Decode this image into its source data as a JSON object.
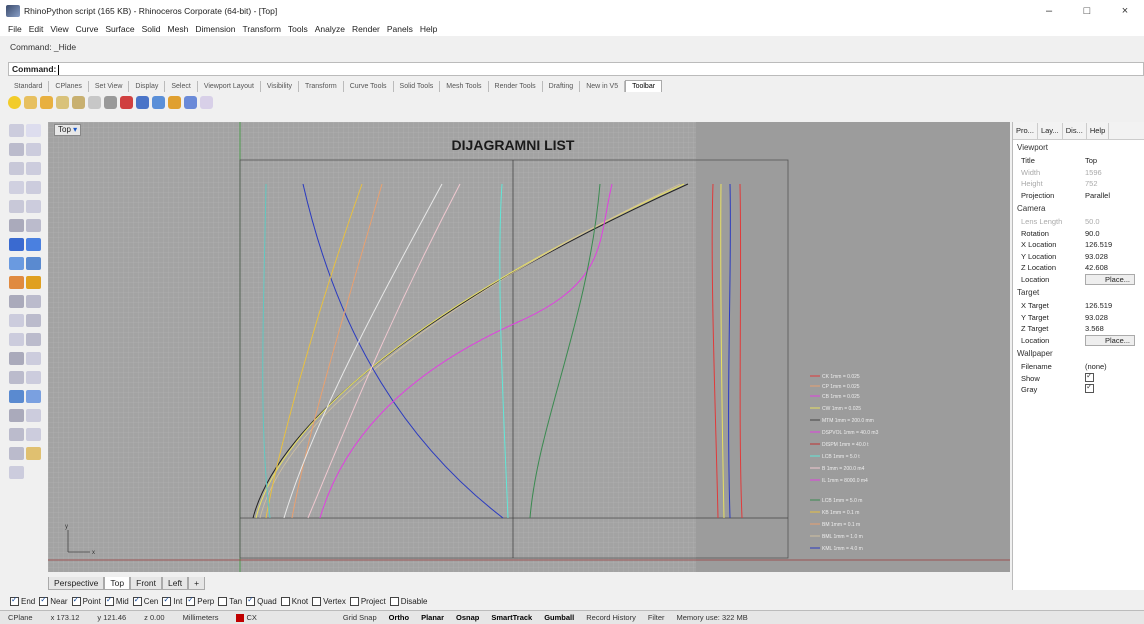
{
  "window": {
    "title": "RhinoPython script (165 KB) - Rhinoceros Corporate (64-bit) - [Top]",
    "controls": [
      "–",
      "□",
      "×"
    ]
  },
  "menu": [
    "File",
    "Edit",
    "View",
    "Curve",
    "Surface",
    "Solid",
    "Mesh",
    "Dimension",
    "Transform",
    "Tools",
    "Analyze",
    "Render",
    "Panels",
    "Help"
  ],
  "command": {
    "history": "Command: _Hide",
    "prompt": "Command:"
  },
  "toolbar_tabs": [
    "Standard",
    "CPlanes",
    "Set View",
    "Display",
    "Select",
    "Viewport Layout",
    "Visibility",
    "Transform",
    "Curve Tools",
    "Solid Tools",
    "Mesh Tools",
    "Render Tools",
    "Drafting",
    "New in V5",
    "Toolbar"
  ],
  "viewport": {
    "label": "Top",
    "heading": "DIJAGRAMNI LIST",
    "legend": [
      "CK 1mm = 0.025",
      "CP 1mm = 0.025",
      "CB 1mm = 0.025",
      "CW 1mm = 0.025",
      "MTM 1mm = 200.0 mm",
      "DSPVOL 1mm = 40.0 m3",
      "DISPM 1mm = 40.0 t",
      "LCB 1mm = 5.0 t",
      "B 1mm = 200.0 m4",
      "IL 1mm = 8000.0 m4",
      "LCB 1mm = 5.0 m",
      "KB 1mm = 0.1 m",
      "BM 1mm = 0.1 m",
      "BML 1mm = 1.0 m",
      "KML 1mm = 4.0 m"
    ],
    "axis_y": "y",
    "axis_x": "x"
  },
  "viewport_tabs": [
    "Perspective",
    "Top",
    "Front",
    "Left",
    "+"
  ],
  "osnaps": [
    {
      "label": "End",
      "on": true
    },
    {
      "label": "Near",
      "on": true
    },
    {
      "label": "Point",
      "on": true
    },
    {
      "label": "Mid",
      "on": true
    },
    {
      "label": "Cen",
      "on": true
    },
    {
      "label": "Int",
      "on": true
    },
    {
      "label": "Perp",
      "on": true
    },
    {
      "label": "Tan",
      "on": false
    },
    {
      "label": "Quad",
      "on": true
    },
    {
      "label": "Knot",
      "on": false
    },
    {
      "label": "Vertex",
      "on": false
    },
    {
      "label": "Project",
      "on": false
    },
    {
      "label": "Disable",
      "on": false
    }
  ],
  "status": {
    "cplane": "CPlane",
    "x": "x 173.12",
    "y": "y 121.46",
    "z": "z 0.00",
    "units": "Millimeters",
    "layer": "CX",
    "panes": [
      "Grid Snap",
      "Ortho",
      "Planar",
      "Osnap",
      "SmartTrack",
      "Gumball",
      "Record History",
      "Filter",
      "Memory use: 322 MB"
    ],
    "bold_panes": [
      "Ortho",
      "Planar",
      "Osnap",
      "SmartTrack",
      "Gumball"
    ],
    "layer_color": "#c00000"
  },
  "panel": {
    "tabs": [
      "Pro...",
      "Lay...",
      "Dis...",
      "Help"
    ],
    "sections": [
      {
        "title": "Viewport",
        "rows": [
          {
            "k": "Title",
            "v": "Top"
          },
          {
            "k": "Width",
            "v": "1596",
            "dim": true
          },
          {
            "k": "Height",
            "v": "752",
            "dim": true
          },
          {
            "k": "Projection",
            "v": "Parallel"
          }
        ]
      },
      {
        "title": "Camera",
        "rows": [
          {
            "k": "Lens Length",
            "v": "50.0",
            "dim": true
          },
          {
            "k": "Rotation",
            "v": "90.0"
          },
          {
            "k": "X Location",
            "v": "126.519"
          },
          {
            "k": "Y Location",
            "v": "93.028"
          },
          {
            "k": "Z Location",
            "v": "42.608"
          },
          {
            "k": "Location",
            "v": "Place...",
            "button": true
          }
        ]
      },
      {
        "title": "Target",
        "rows": [
          {
            "k": "X Target",
            "v": "126.519"
          },
          {
            "k": "Y Target",
            "v": "93.028"
          },
          {
            "k": "Z Target",
            "v": "3.568"
          },
          {
            "k": "Location",
            "v": "Place...",
            "button": true
          }
        ]
      },
      {
        "title": "Wallpaper",
        "rows": [
          {
            "k": "Filename",
            "v": "(none)"
          },
          {
            "k": "Show",
            "v": "",
            "check": true
          },
          {
            "k": "Gray",
            "v": "",
            "check": true
          }
        ]
      }
    ]
  }
}
